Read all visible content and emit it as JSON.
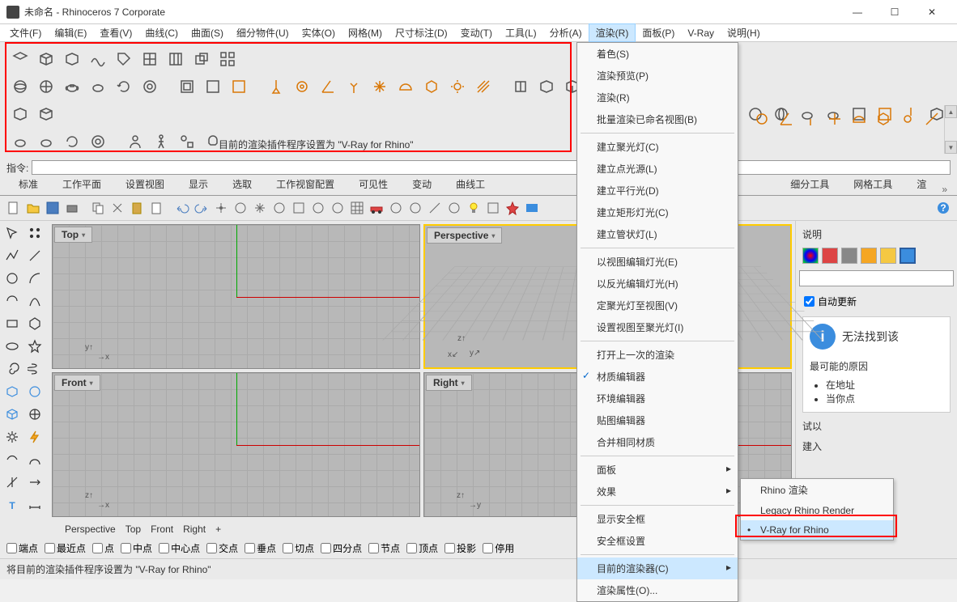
{
  "window": {
    "title": "未命名 - Rhinoceros 7 Corporate"
  },
  "menu": {
    "file": "文件(F)",
    "edit": "编辑(E)",
    "view": "查看(V)",
    "curve": "曲线(C)",
    "surface": "曲面(S)",
    "solid": "细分物件(U)",
    "entity": "实体(O)",
    "mesh": "网格(M)",
    "dimension": "尺寸标注(D)",
    "transform": "变动(T)",
    "tools": "工具(L)",
    "analyze": "分析(A)",
    "render": "渲染(R)",
    "panel": "面板(P)",
    "vray": "V-Ray",
    "help": "说明(H)"
  },
  "render_menu": {
    "shade": "着色(S)",
    "preview": "渲染预览(P)",
    "render": "渲染(R)",
    "batch": "批量渲染已命名视图(B)",
    "spot": "建立聚光灯(C)",
    "point": "建立点光源(L)",
    "parallel": "建立平行光(D)",
    "rect": "建立矩形灯光(C)",
    "tube": "建立管状灯(L)",
    "editview": "以视图编辑灯光(E)",
    "editrefl": "以反光编辑灯光(H)",
    "spotview": "定聚光灯至视图(V)",
    "viewspot": "设置视图至聚光灯(I)",
    "lastopen": "打开上一次的渲染",
    "mateditor": "材质编辑器",
    "enveditor": "环境编辑器",
    "texeditor": "贴图编辑器",
    "merge": "合并相同材质",
    "panels": "面板",
    "effects": "效果",
    "safeframe": "显示安全框",
    "safesettings": "安全框设置",
    "current": "目前的渲染器(C)",
    "props": "渲染属性(O)..."
  },
  "submenu": {
    "rhino": "Rhino 渲染",
    "legacy": "Legacy Rhino Render",
    "vray": "V-Ray for Rhino"
  },
  "tabs": {
    "std": "标准",
    "wp": "工作平面",
    "setv": "设置视图",
    "disp": "显示",
    "sel": "选取",
    "vpcfg": "工作视窗配置",
    "vis": "可见性",
    "trans": "变动",
    "curvet": "曲线工",
    "subd": "细分工具",
    "mesht": "网格工具",
    "rendert": "渲"
  },
  "cmd": {
    "info": "目前的渲染插件程序设置为 \"V-Ray for Rhino\"",
    "label": "指令:"
  },
  "vp": {
    "top": "Top",
    "persp": "Perspective",
    "front": "Front",
    "right": "Right"
  },
  "vtabs": {
    "persp": "Perspective",
    "top": "Top",
    "front": "Front",
    "right": "Right",
    "plus": "+"
  },
  "osnap": {
    "end": "端点",
    "near": "最近点",
    "pt": "点",
    "mid": "中点",
    "cen": "中心点",
    "int": "交点",
    "perp": "垂点",
    "tan": "切点",
    "quad": "四分点",
    "knot": "节点",
    "vtx": "顶点",
    "proj": "投影",
    "disable": "停用"
  },
  "status": {
    "text": "将目前的渲染插件程序设置为 \"V-Ray for Rhino\""
  },
  "panel": {
    "title": "说明",
    "auto": "自动更新",
    "warn": "无法找到该",
    "cause": "最可能的原因",
    "l1": "在地址",
    "l2": "当你点",
    "more": "试以",
    "more2": "建入"
  }
}
